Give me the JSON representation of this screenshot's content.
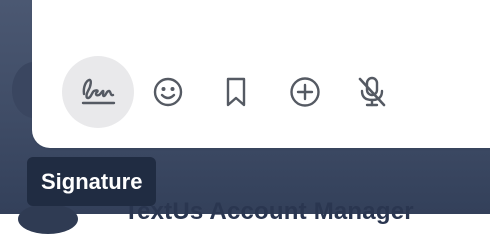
{
  "composer": {
    "tools": [
      {
        "name": "signature",
        "icon": "signature-icon",
        "selected": true
      },
      {
        "name": "emoji",
        "icon": "smiley-icon"
      },
      {
        "name": "bookmark",
        "icon": "bookmark-icon"
      },
      {
        "name": "add",
        "icon": "plus-circle-icon"
      },
      {
        "name": "microphone",
        "icon": "microphone-muted-icon"
      }
    ],
    "tooltip": "Signature"
  },
  "background": {
    "partial_heading": "TextUs Account Manager"
  },
  "colors": {
    "backdrop": "#3f4c66",
    "panel": "#ffffff",
    "icon": "#555a63",
    "selected_bg": "#e9e9eb",
    "tooltip_bg": "#202c42",
    "tooltip_text": "#ffffff"
  }
}
